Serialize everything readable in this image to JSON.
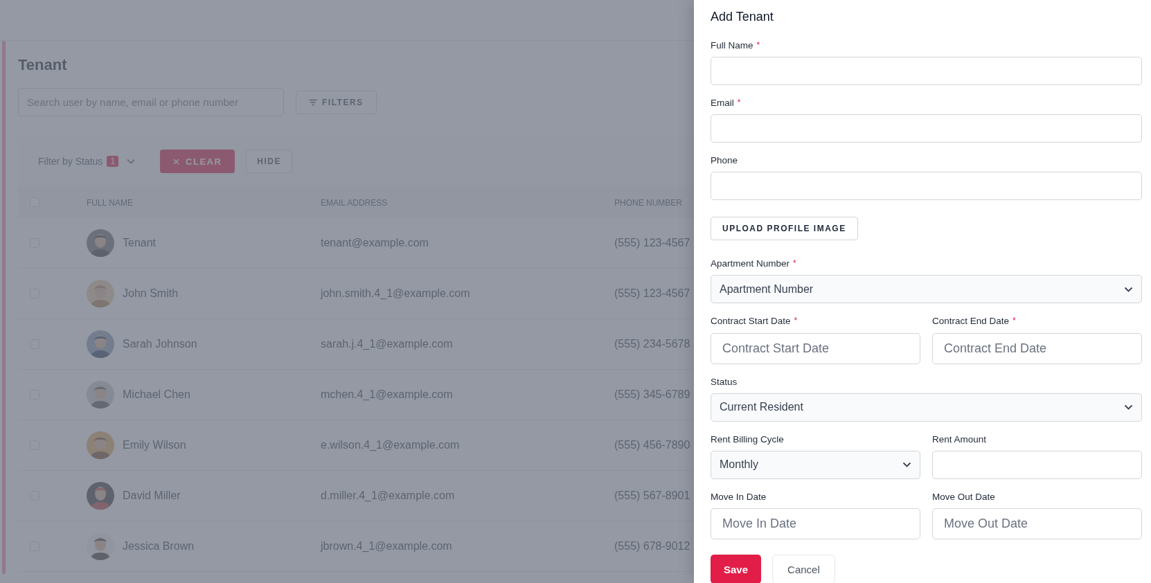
{
  "page": {
    "title": "Tenant",
    "search": {
      "placeholder": "Search user by name, email or phone number"
    },
    "filters_button": "FILTERS"
  },
  "filter_bar": {
    "label": "Filter by Status",
    "count": "1",
    "clear_button": "CLEAR",
    "hide_button": "HIDE"
  },
  "table": {
    "header_checked": false,
    "columns": [
      "FULL NAME",
      "EMAIL ADDRESS",
      "PHONE NUMBER"
    ],
    "rows": [
      {
        "checked": false,
        "name": "Tenant",
        "email": "tenant@example.com",
        "phone": "(555) 123-4567"
      },
      {
        "checked": false,
        "name": "John Smith",
        "email": "john.smith.4_1@example.com",
        "phone": "(555) 123-4567"
      },
      {
        "checked": false,
        "name": "Sarah Johnson",
        "email": "sarah.j.4_1@example.com",
        "phone": "(555) 234-5678"
      },
      {
        "checked": false,
        "name": "Michael Chen",
        "email": "mchen.4_1@example.com",
        "phone": "(555) 345-6789"
      },
      {
        "checked": false,
        "name": "Emily Wilson",
        "email": "e.wilson.4_1@example.com",
        "phone": "(555) 456-7890"
      },
      {
        "checked": false,
        "name": "David Miller",
        "email": "d.miller.4_1@example.com",
        "phone": "(555) 567-8901"
      },
      {
        "checked": false,
        "name": "Jessica Brown",
        "email": "jbrown.4_1@example.com",
        "phone": "(555) 678-9012"
      }
    ]
  },
  "drawer": {
    "title": "Add Tenant",
    "rows": [
      [
        {
          "kind": "text",
          "label": "Full Name",
          "required_mark": "*"
        }
      ],
      [
        {
          "kind": "text",
          "label": "Email",
          "required_mark": "*"
        }
      ],
      [
        {
          "kind": "text",
          "label": "Phone"
        }
      ],
      [
        {
          "kind": "button",
          "label": "UPLOAD PROFILE IMAGE"
        }
      ],
      [
        {
          "kind": "select",
          "label": "Apartment Number",
          "required_mark": "*",
          "value": "Apartment Number"
        }
      ],
      [
        {
          "kind": "date",
          "label": "Contract Start Date",
          "required_mark": "*",
          "placeholder": "Contract Start Date"
        },
        {
          "kind": "date",
          "label": "Contract End Date",
          "required_mark": "*",
          "placeholder": "Contract End Date"
        }
      ],
      [
        {
          "kind": "select",
          "label": "Status",
          "value": "Current Resident"
        }
      ],
      [
        {
          "kind": "select",
          "label": "Rent Billing Cycle",
          "value": "Monthly"
        },
        {
          "kind": "text",
          "label": "Rent Amount"
        }
      ],
      [
        {
          "kind": "date",
          "label": "Move In Date",
          "placeholder": "Move In Date"
        },
        {
          "kind": "date",
          "label": "Move Out Date",
          "placeholder": "Move Out Date"
        }
      ]
    ],
    "actions": [
      {
        "kind": "primary",
        "label": "Save"
      },
      {
        "kind": "secondary",
        "label": "Cancel"
      }
    ]
  }
}
